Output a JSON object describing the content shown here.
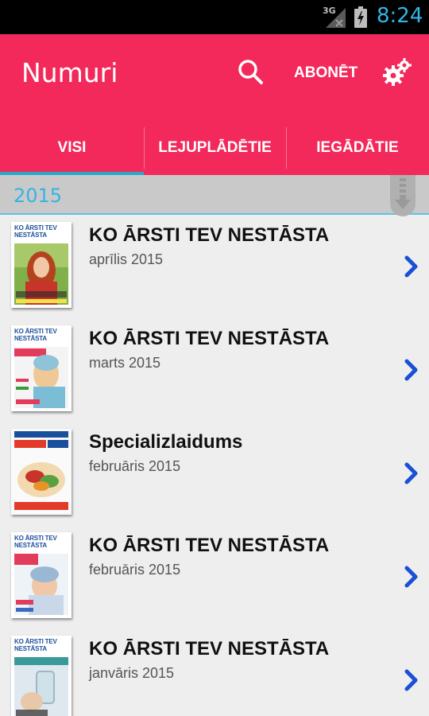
{
  "status_bar": {
    "network": "3G",
    "time": "8:24"
  },
  "app_bar": {
    "title": "Numuri",
    "subscribe_label": "ABONĒT"
  },
  "tabs": [
    {
      "label": "VISI",
      "selected": true
    },
    {
      "label": "LEJUPLĀDĒTIE",
      "selected": false
    },
    {
      "label": "IEGĀDĀTIE",
      "selected": false
    }
  ],
  "section": {
    "year": "2015"
  },
  "issues": [
    {
      "title": "KO ĀRSTI TEV NESTĀSTA",
      "date": "aprīlis 2015",
      "cover_masthead": "KO ĀRSTI TEV NESTĀSTA"
    },
    {
      "title": "KO ĀRSTI TEV NESTĀSTA",
      "date": "marts 2015",
      "cover_masthead": "KO ĀRSTI TEV NESTĀSTA"
    },
    {
      "title": "Specializlaidums",
      "date": "februāris 2015",
      "cover_masthead": ""
    },
    {
      "title": "KO ĀRSTI TEV NESTĀSTA",
      "date": "februāris 2015",
      "cover_masthead": "KO ĀRSTI TEV NESTĀSTA"
    },
    {
      "title": "KO ĀRSTI TEV NESTĀSTA",
      "date": "janvāris 2015",
      "cover_masthead": "KO ĀRSTI TEV NESTĀSTA"
    }
  ],
  "colors": {
    "app_bar": "#f2295a",
    "accent": "#33b5e5",
    "chevron": "#1a4fd6",
    "tab_indicator": "#2aa6c9"
  }
}
